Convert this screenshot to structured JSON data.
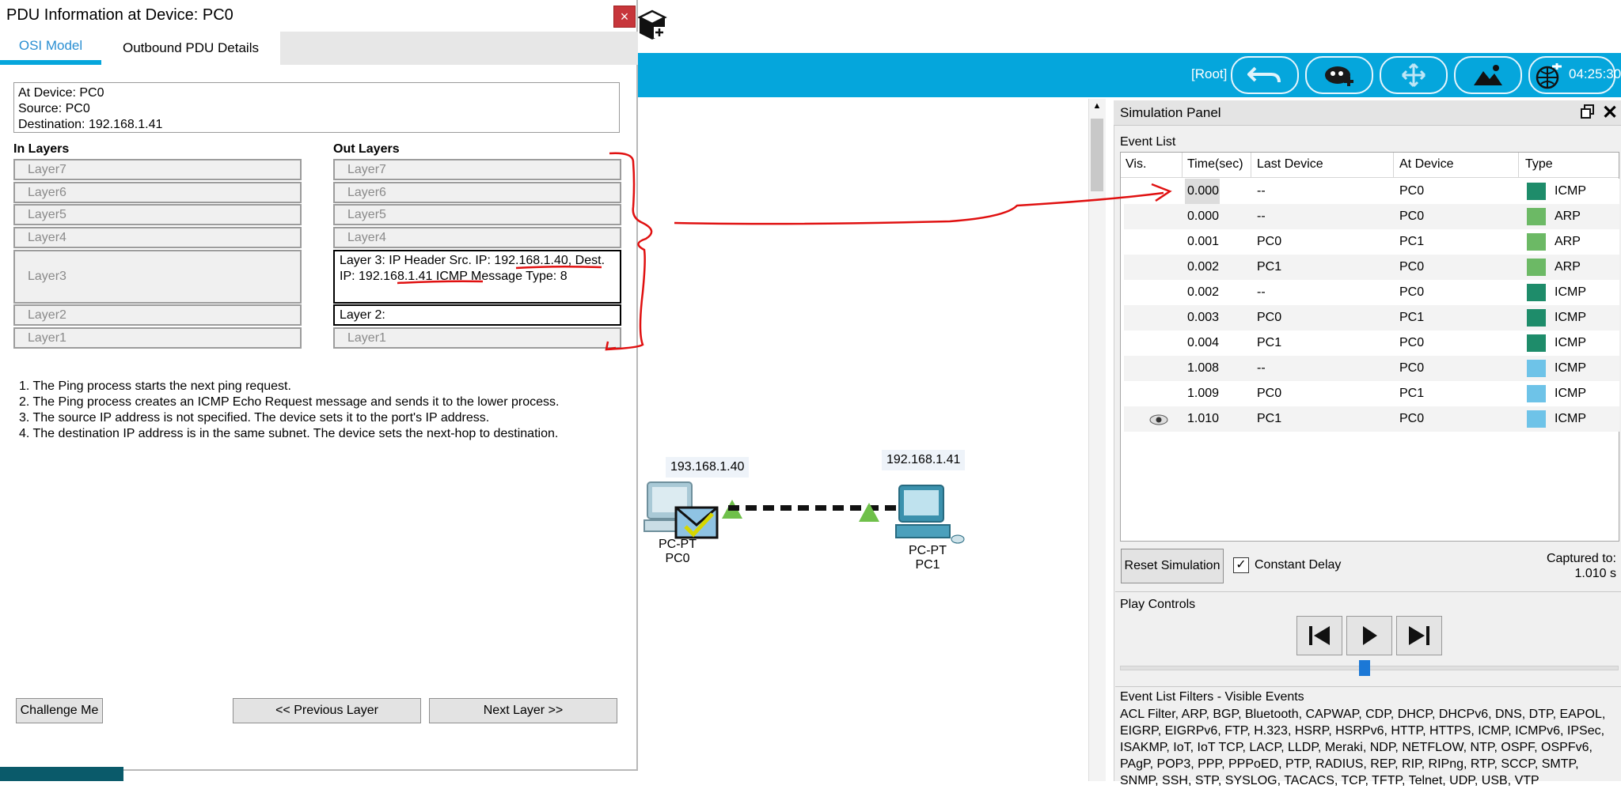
{
  "dialog": {
    "title": "PDU Information at Device: PC0",
    "close_label": "×",
    "tabs": [
      {
        "label": "OSI Model"
      },
      {
        "label": "Outbound PDU Details"
      }
    ],
    "info": {
      "device_line": "At Device: PC0",
      "source_line": "Source: PC0",
      "destination_line": "Destination: 192.168.1.41"
    },
    "in_layers_header": "In Layers",
    "out_layers_header": "Out Layers",
    "in_layers": [
      "Layer7",
      "Layer6",
      "Layer5",
      "Layer4",
      "Layer3",
      "Layer2",
      "Layer1"
    ],
    "out_layers": {
      "l7": "Layer7",
      "l6": "Layer6",
      "l5": "Layer5",
      "l4": "Layer4",
      "l3_prefix": "Layer 3: IP Header Src. IP: ",
      "l3_src_ip": "192.168.1.40",
      "l3_mid": ", Dest. IP: ",
      "l3_dest_ip": "192.168.1.41",
      "l3_suffix": " ICMP Message Type: 8",
      "l2": "Layer 2:",
      "l1": "Layer1"
    },
    "steps": [
      "1. The Ping process starts the next ping request.",
      "2. The Ping process creates an ICMP Echo Request message and sends it to the lower process.",
      "3. The source IP address is not specified. The device sets it to the port's IP address.",
      "4. The destination IP address is in the same subnet. The device sets the next-hop to destination."
    ],
    "buttons": {
      "challenge": "Challenge Me",
      "previous": "<< Previous Layer",
      "next": "Next Layer >>"
    }
  },
  "toolbar": {
    "root_label": "[Root]",
    "clock": "04:25:30",
    "icons": [
      "back-arrow-icon",
      "cloud-add-icon",
      "move-icon",
      "landscape-icon",
      "globe-clock-icon"
    ]
  },
  "topology": {
    "pc0": {
      "ip": "193.168.1.40",
      "model": "PC-PT",
      "name": "PC0"
    },
    "pc1": {
      "ip": "192.168.1.41",
      "model": "PC-PT",
      "name": "PC1"
    }
  },
  "simulation": {
    "title": "Simulation Panel",
    "event_list_label": "Event List",
    "columns": [
      "Vis.",
      "Time(sec)",
      "Last Device",
      "At Device",
      "Type"
    ],
    "events": [
      {
        "time": "0.000",
        "last": "--",
        "at": "PC0",
        "type": "ICMP",
        "color": "#1e8c6a"
      },
      {
        "time": "0.000",
        "last": "--",
        "at": "PC0",
        "type": "ARP",
        "color": "#6cb965"
      },
      {
        "time": "0.001",
        "last": "PC0",
        "at": "PC1",
        "type": "ARP",
        "color": "#6cb965"
      },
      {
        "time": "0.002",
        "last": "PC1",
        "at": "PC0",
        "type": "ARP",
        "color": "#6cb965"
      },
      {
        "time": "0.002",
        "last": "--",
        "at": "PC0",
        "type": "ICMP",
        "color": "#1e8c6a"
      },
      {
        "time": "0.003",
        "last": "PC0",
        "at": "PC1",
        "type": "ICMP",
        "color": "#1e8c6a"
      },
      {
        "time": "0.004",
        "last": "PC1",
        "at": "PC0",
        "type": "ICMP",
        "color": "#1e8c6a"
      },
      {
        "time": "1.008",
        "last": "--",
        "at": "PC0",
        "type": "ICMP",
        "color": "#6ec3e8"
      },
      {
        "time": "1.009",
        "last": "PC0",
        "at": "PC1",
        "type": "ICMP",
        "color": "#6ec3e8"
      },
      {
        "time": "1.010",
        "last": "PC1",
        "at": "PC0",
        "type": "ICMP",
        "color": "#6ec3e8"
      }
    ],
    "reset_label": "Reset Simulation",
    "constant_delay_label": "Constant Delay",
    "constant_delay_checked": true,
    "captured_label": "Captured to:",
    "captured_value": "1.010 s",
    "play_controls_label": "Play Controls",
    "slider_position": 0.49,
    "filters_label": "Event List Filters - Visible Events",
    "filters_text": "ACL Filter, ARP, BGP, Bluetooth, CAPWAP, CDP, DHCP, DHCPv6, DNS, DTP, EAPOL, EIGRP, EIGRPv6, FTP, H.323, HSRP, HSRPv6, HTTP, HTTPS, ICMP, ICMPv6, IPSec, ISAKMP, IoT, IoT TCP, LACP, LLDP, Meraki, NDP, NETFLOW, NTP, OSPF, OSPFv6, PAgP, POP3, PPP, PPPoED, PTP, RADIUS, REP, RIP, RIPng, RTP, SCCP, SMTP, SNMP, SSH, STP, SYSLOG, TACACS, TCP, TFTP, Telnet, UDP, USB, VTP"
  }
}
